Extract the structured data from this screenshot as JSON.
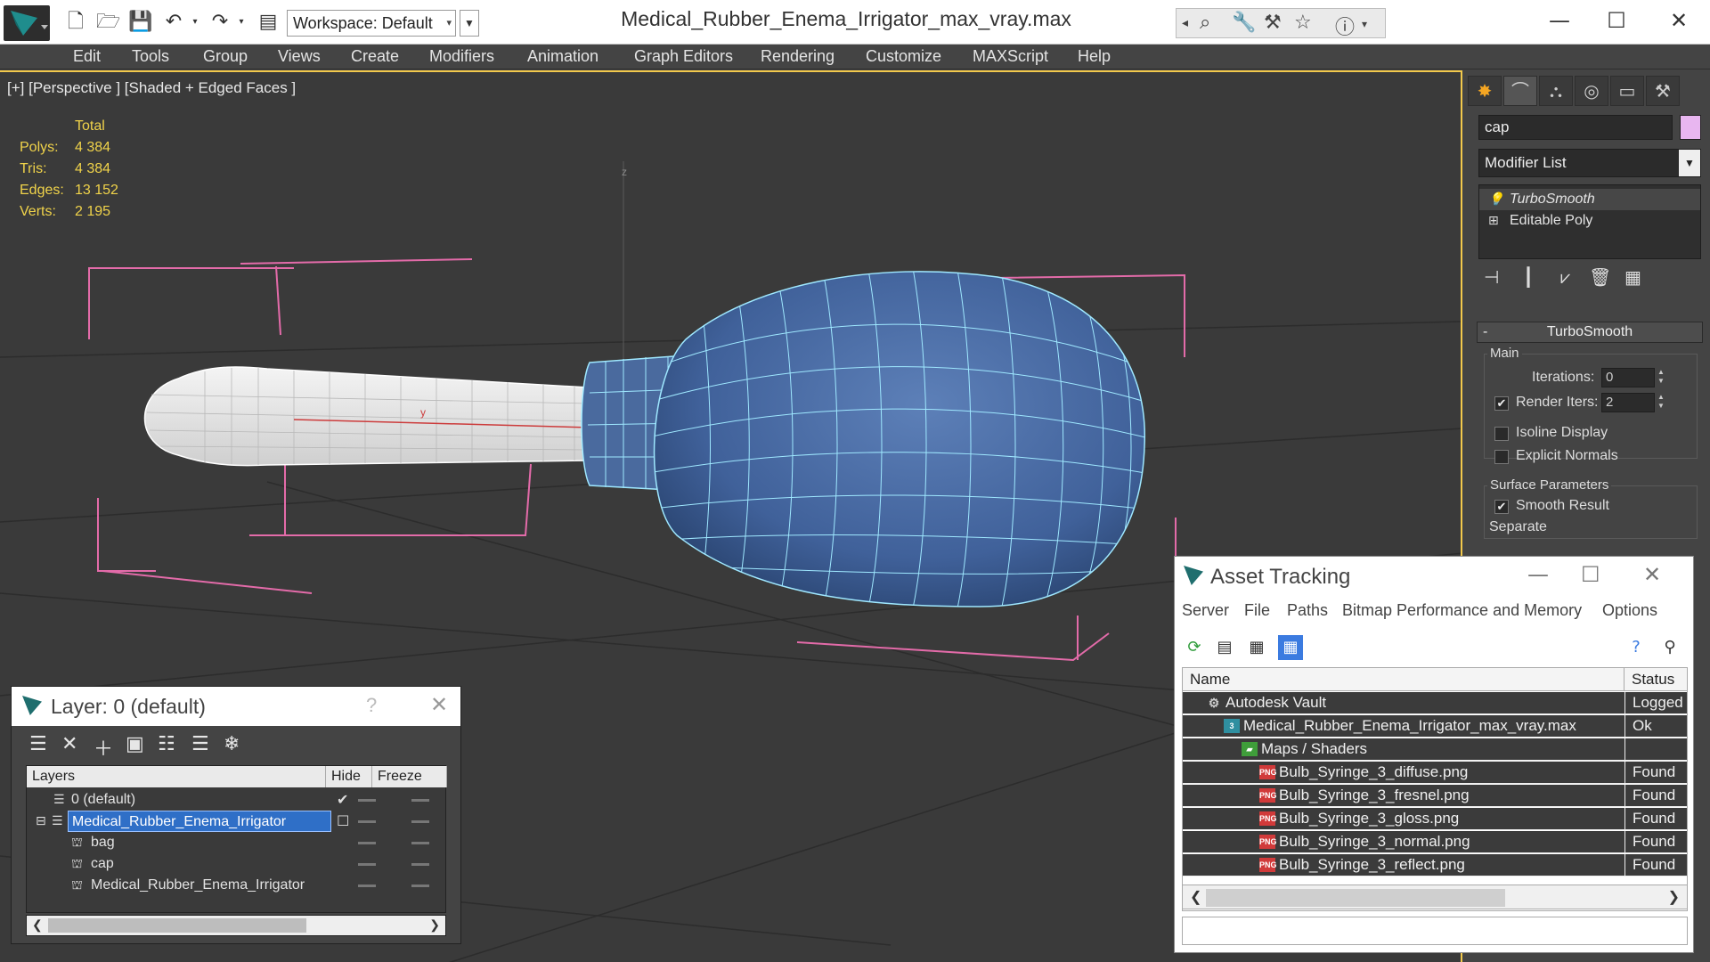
{
  "titlebar": {
    "workspace": "Workspace: Default",
    "doc_title": "Medical_Rubber_Enema_Irrigator_max_vray.max",
    "win_minimize": "—",
    "win_maximize": "☐",
    "win_close": "✕"
  },
  "menu": {
    "items": [
      "Edit",
      "Tools",
      "Group",
      "Views",
      "Create",
      "Modifiers",
      "Animation",
      "Graph Editors",
      "Rendering",
      "Customize",
      "MAXScript",
      "Help"
    ]
  },
  "viewport": {
    "label": "[+] [Perspective ] [Shaded + Edged Faces ]",
    "axis_z": "z",
    "axis_y": "y",
    "stats": {
      "header": "Total",
      "polys_label": "Polys:",
      "polys": "4 384",
      "tris_label": "Tris:",
      "tris": "4 384",
      "edges_label": "Edges:",
      "edges": "13 152",
      "verts_label": "Verts:",
      "verts": "2 195"
    },
    "colors": {
      "bg": "#3a3a3a",
      "bulb": "#4a6a9e",
      "wire": "#9fe8ff",
      "bbox": "#e36ba9",
      "tube": "#e8e8e8",
      "active_border": "#f2c94c"
    }
  },
  "command_panel": {
    "object_name": "cap",
    "object_color": "#e8b6f0",
    "modifier_list": "Modifier List",
    "stack": [
      "TurboSmooth",
      "Editable Poly"
    ],
    "rollout_title": "TurboSmooth",
    "main_group": "Main",
    "iterations_label": "Iterations:",
    "iterations": "0",
    "render_iters_label": "Render Iters:",
    "render_iters": "2",
    "render_iters_checked": true,
    "isoline_label": "Isoline Display",
    "explicit_normals_label": "Explicit Normals",
    "surface_group": "Surface Parameters",
    "smooth_result_label": "Smooth Result",
    "separate_label": "Separate"
  },
  "layer_dialog": {
    "title": "Layer: 0 (default)",
    "help": "?",
    "close": "✕",
    "columns": [
      "Layers",
      "Hide",
      "Freeze"
    ],
    "rows": [
      {
        "name": "0 (default)",
        "level": 0
      },
      {
        "name": "Medical_Rubber_Enema_Irrigator",
        "level": 0
      },
      {
        "name": "bag",
        "level": 1
      },
      {
        "name": "cap",
        "level": 1
      },
      {
        "name": "Medical_Rubber_Enema_Irrigator",
        "level": 1
      }
    ]
  },
  "asset_dialog": {
    "title": "Asset Tracking",
    "menu": [
      "Server",
      "File",
      "Paths",
      "Bitmap Performance and Memory",
      "Options"
    ],
    "columns": [
      "Name",
      "Status"
    ],
    "rows": [
      {
        "name": "Autodesk Vault",
        "status": "Logged C"
      },
      {
        "name": "Medical_Rubber_Enema_Irrigator_max_vray.max",
        "status": "Ok"
      },
      {
        "name": "Maps / Shaders",
        "status": ""
      },
      {
        "name": "Bulb_Syringe_3_diffuse.png",
        "status": "Found"
      },
      {
        "name": "Bulb_Syringe_3_fresnel.png",
        "status": "Found"
      },
      {
        "name": "Bulb_Syringe_3_gloss.png",
        "status": "Found"
      },
      {
        "name": "Bulb_Syringe_3_normal.png",
        "status": "Found"
      },
      {
        "name": "Bulb_Syringe_3_reflect.png",
        "status": "Found"
      }
    ],
    "png_badge": "PNG"
  }
}
